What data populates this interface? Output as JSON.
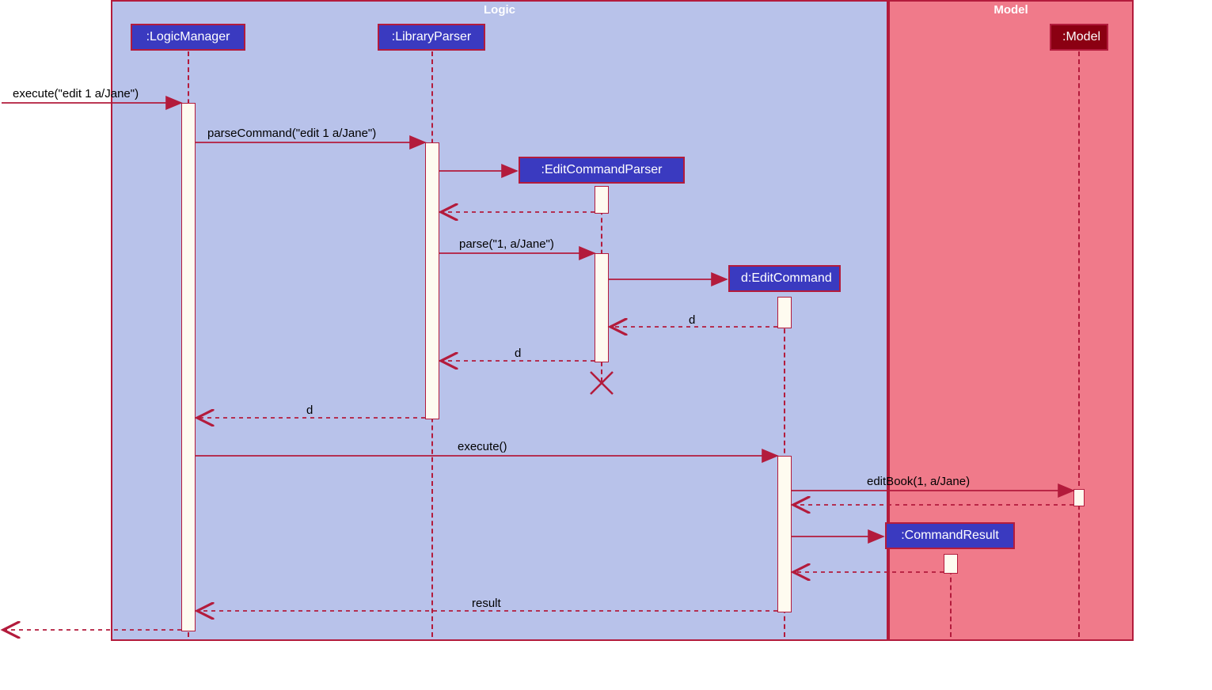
{
  "frames": {
    "logic": "Logic",
    "model": "Model"
  },
  "participants": {
    "logicManager": ":LogicManager",
    "libraryParser": ":LibraryParser",
    "editCommandParser": ":EditCommandParser",
    "editCommand": "d:EditCommand",
    "commandResult": ":CommandResult",
    "model": ":Model"
  },
  "messages": {
    "execute_in": "execute(\"edit 1 a/Jane\")",
    "parseCommand": "parseCommand(\"edit 1 a/Jane\")",
    "parse": "parse(\"1, a/Jane\")",
    "return_d1": "d",
    "return_d2": "d",
    "return_d3": "d",
    "executeCall": "execute()",
    "editBook": "editBook(1, a/Jane)",
    "result": "result"
  },
  "chart_data": {
    "type": "uml_sequence",
    "frames": [
      {
        "name": "Logic",
        "participants": [
          "LogicManager",
          "LibraryParser",
          "EditCommandParser",
          "d:EditCommand",
          "CommandResult"
        ]
      },
      {
        "name": "Model",
        "participants": [
          "Model"
        ]
      }
    ],
    "participants": [
      {
        "id": "LogicManager",
        "label": ":LogicManager"
      },
      {
        "id": "LibraryParser",
        "label": ":LibraryParser"
      },
      {
        "id": "EditCommandParser",
        "label": ":EditCommandParser",
        "created_by": "LibraryParser",
        "destroyed": true
      },
      {
        "id": "EditCommand",
        "label": "d:EditCommand",
        "created_by": "EditCommandParser"
      },
      {
        "id": "CommandResult",
        "label": ":CommandResult",
        "created_by": "EditCommand"
      },
      {
        "id": "Model",
        "label": ":Model"
      }
    ],
    "messages": [
      {
        "from": "external",
        "to": "LogicManager",
        "label": "execute(\"edit 1 a/Jane\")",
        "type": "sync"
      },
      {
        "from": "LogicManager",
        "to": "LibraryParser",
        "label": "parseCommand(\"edit 1 a/Jane\")",
        "type": "sync"
      },
      {
        "from": "LibraryParser",
        "to": "EditCommandParser",
        "label": "",
        "type": "create"
      },
      {
        "from": "EditCommandParser",
        "to": "LibraryParser",
        "label": "",
        "type": "return"
      },
      {
        "from": "LibraryParser",
        "to": "EditCommandParser",
        "label": "parse(\"1, a/Jane\")",
        "type": "sync"
      },
      {
        "from": "EditCommandParser",
        "to": "EditCommand",
        "label": "",
        "type": "create"
      },
      {
        "from": "EditCommand",
        "to": "EditCommandParser",
        "label": "d",
        "type": "return"
      },
      {
        "from": "EditCommandParser",
        "to": "LibraryParser",
        "label": "d",
        "type": "return"
      },
      {
        "from": "LibraryParser",
        "to": "LogicManager",
        "label": "d",
        "type": "return"
      },
      {
        "from": "LogicManager",
        "to": "EditCommand",
        "label": "execute()",
        "type": "sync"
      },
      {
        "from": "EditCommand",
        "to": "Model",
        "label": "editBook(1, a/Jane)",
        "type": "sync"
      },
      {
        "from": "Model",
        "to": "EditCommand",
        "label": "",
        "type": "return"
      },
      {
        "from": "EditCommand",
        "to": "CommandResult",
        "label": "",
        "type": "create"
      },
      {
        "from": "CommandResult",
        "to": "EditCommand",
        "label": "",
        "type": "return"
      },
      {
        "from": "EditCommand",
        "to": "LogicManager",
        "label": "result",
        "type": "return"
      },
      {
        "from": "LogicManager",
        "to": "external",
        "label": "",
        "type": "return"
      }
    ]
  }
}
